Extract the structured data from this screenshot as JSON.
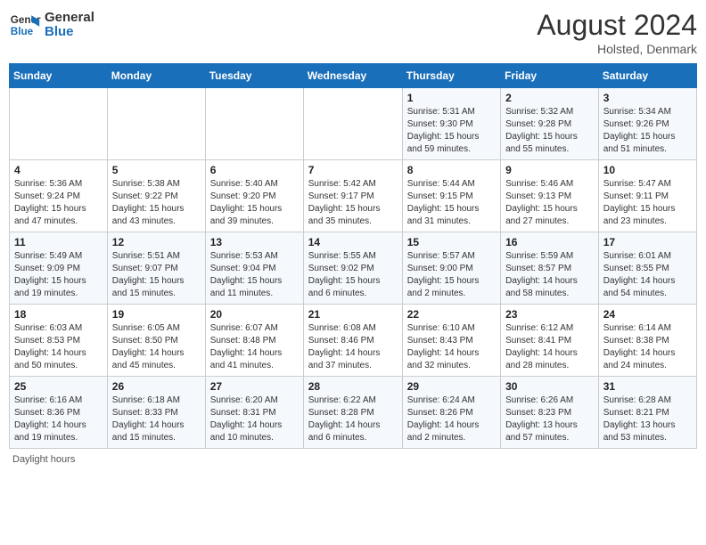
{
  "header": {
    "logo_line1": "General",
    "logo_line2": "Blue",
    "month_year": "August 2024",
    "location": "Holsted, Denmark"
  },
  "days_of_week": [
    "Sunday",
    "Monday",
    "Tuesday",
    "Wednesday",
    "Thursday",
    "Friday",
    "Saturday"
  ],
  "weeks": [
    [
      {
        "day": "",
        "info": ""
      },
      {
        "day": "",
        "info": ""
      },
      {
        "day": "",
        "info": ""
      },
      {
        "day": "",
        "info": ""
      },
      {
        "day": "1",
        "info": "Sunrise: 5:31 AM\nSunset: 9:30 PM\nDaylight: 15 hours\nand 59 minutes."
      },
      {
        "day": "2",
        "info": "Sunrise: 5:32 AM\nSunset: 9:28 PM\nDaylight: 15 hours\nand 55 minutes."
      },
      {
        "day": "3",
        "info": "Sunrise: 5:34 AM\nSunset: 9:26 PM\nDaylight: 15 hours\nand 51 minutes."
      }
    ],
    [
      {
        "day": "4",
        "info": "Sunrise: 5:36 AM\nSunset: 9:24 PM\nDaylight: 15 hours\nand 47 minutes."
      },
      {
        "day": "5",
        "info": "Sunrise: 5:38 AM\nSunset: 9:22 PM\nDaylight: 15 hours\nand 43 minutes."
      },
      {
        "day": "6",
        "info": "Sunrise: 5:40 AM\nSunset: 9:20 PM\nDaylight: 15 hours\nand 39 minutes."
      },
      {
        "day": "7",
        "info": "Sunrise: 5:42 AM\nSunset: 9:17 PM\nDaylight: 15 hours\nand 35 minutes."
      },
      {
        "day": "8",
        "info": "Sunrise: 5:44 AM\nSunset: 9:15 PM\nDaylight: 15 hours\nand 31 minutes."
      },
      {
        "day": "9",
        "info": "Sunrise: 5:46 AM\nSunset: 9:13 PM\nDaylight: 15 hours\nand 27 minutes."
      },
      {
        "day": "10",
        "info": "Sunrise: 5:47 AM\nSunset: 9:11 PM\nDaylight: 15 hours\nand 23 minutes."
      }
    ],
    [
      {
        "day": "11",
        "info": "Sunrise: 5:49 AM\nSunset: 9:09 PM\nDaylight: 15 hours\nand 19 minutes."
      },
      {
        "day": "12",
        "info": "Sunrise: 5:51 AM\nSunset: 9:07 PM\nDaylight: 15 hours\nand 15 minutes."
      },
      {
        "day": "13",
        "info": "Sunrise: 5:53 AM\nSunset: 9:04 PM\nDaylight: 15 hours\nand 11 minutes."
      },
      {
        "day": "14",
        "info": "Sunrise: 5:55 AM\nSunset: 9:02 PM\nDaylight: 15 hours\nand 6 minutes."
      },
      {
        "day": "15",
        "info": "Sunrise: 5:57 AM\nSunset: 9:00 PM\nDaylight: 15 hours\nand 2 minutes."
      },
      {
        "day": "16",
        "info": "Sunrise: 5:59 AM\nSunset: 8:57 PM\nDaylight: 14 hours\nand 58 minutes."
      },
      {
        "day": "17",
        "info": "Sunrise: 6:01 AM\nSunset: 8:55 PM\nDaylight: 14 hours\nand 54 minutes."
      }
    ],
    [
      {
        "day": "18",
        "info": "Sunrise: 6:03 AM\nSunset: 8:53 PM\nDaylight: 14 hours\nand 50 minutes."
      },
      {
        "day": "19",
        "info": "Sunrise: 6:05 AM\nSunset: 8:50 PM\nDaylight: 14 hours\nand 45 minutes."
      },
      {
        "day": "20",
        "info": "Sunrise: 6:07 AM\nSunset: 8:48 PM\nDaylight: 14 hours\nand 41 minutes."
      },
      {
        "day": "21",
        "info": "Sunrise: 6:08 AM\nSunset: 8:46 PM\nDaylight: 14 hours\nand 37 minutes."
      },
      {
        "day": "22",
        "info": "Sunrise: 6:10 AM\nSunset: 8:43 PM\nDaylight: 14 hours\nand 32 minutes."
      },
      {
        "day": "23",
        "info": "Sunrise: 6:12 AM\nSunset: 8:41 PM\nDaylight: 14 hours\nand 28 minutes."
      },
      {
        "day": "24",
        "info": "Sunrise: 6:14 AM\nSunset: 8:38 PM\nDaylight: 14 hours\nand 24 minutes."
      }
    ],
    [
      {
        "day": "25",
        "info": "Sunrise: 6:16 AM\nSunset: 8:36 PM\nDaylight: 14 hours\nand 19 minutes."
      },
      {
        "day": "26",
        "info": "Sunrise: 6:18 AM\nSunset: 8:33 PM\nDaylight: 14 hours\nand 15 minutes."
      },
      {
        "day": "27",
        "info": "Sunrise: 6:20 AM\nSunset: 8:31 PM\nDaylight: 14 hours\nand 10 minutes."
      },
      {
        "day": "28",
        "info": "Sunrise: 6:22 AM\nSunset: 8:28 PM\nDaylight: 14 hours\nand 6 minutes."
      },
      {
        "day": "29",
        "info": "Sunrise: 6:24 AM\nSunset: 8:26 PM\nDaylight: 14 hours\nand 2 minutes."
      },
      {
        "day": "30",
        "info": "Sunrise: 6:26 AM\nSunset: 8:23 PM\nDaylight: 13 hours\nand 57 minutes."
      },
      {
        "day": "31",
        "info": "Sunrise: 6:28 AM\nSunset: 8:21 PM\nDaylight: 13 hours\nand 53 minutes."
      }
    ]
  ],
  "footer": {
    "daylight_label": "Daylight hours"
  }
}
